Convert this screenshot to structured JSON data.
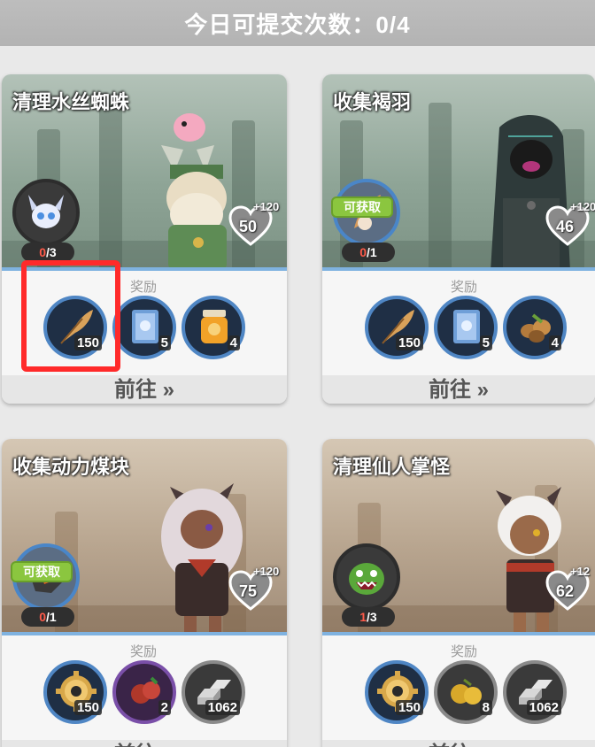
{
  "header": {
    "daily_submissions": "今日可提交次数：0/4"
  },
  "common": {
    "reward_label": "奖励",
    "go_label": "前往 »"
  },
  "cards": [
    {
      "title": "清理水丝蜘蛛",
      "progress_current": "0",
      "progress_total": "/3",
      "claimable": "",
      "hp": "50",
      "bonus": "+120",
      "rewards": [
        {
          "icon": "feather-icon",
          "qty": "150"
        },
        {
          "icon": "book-icon",
          "qty": "5"
        },
        {
          "icon": "honey-jar-icon",
          "qty": "4"
        }
      ]
    },
    {
      "title": "收集褐羽",
      "progress_current": "0",
      "progress_total": "/1",
      "claimable": "可获取",
      "hp": "46",
      "bonus": "+120",
      "rewards": [
        {
          "icon": "feather-icon",
          "qty": "150"
        },
        {
          "icon": "book-icon",
          "qty": "5"
        },
        {
          "icon": "nuts-icon",
          "qty": "4"
        }
      ]
    },
    {
      "title": "收集动力煤块",
      "progress_current": "0",
      "progress_total": "/1",
      "claimable": "可获取",
      "hp": "75",
      "bonus": "+120",
      "rewards": [
        {
          "icon": "gear-icon",
          "qty": "150"
        },
        {
          "icon": "berry-icon",
          "qty": "2"
        },
        {
          "icon": "ingot-icon",
          "qty": "1062"
        }
      ]
    },
    {
      "title": "清理仙人掌怪",
      "progress_current": "1",
      "progress_total": "/3",
      "claimable": "",
      "hp": "62",
      "bonus": "+12",
      "rewards": [
        {
          "icon": "gear-icon",
          "qty": "150"
        },
        {
          "icon": "golden-fruit-icon",
          "qty": "8"
        },
        {
          "icon": "ingot-icon",
          "qty": "1062"
        }
      ]
    }
  ]
}
